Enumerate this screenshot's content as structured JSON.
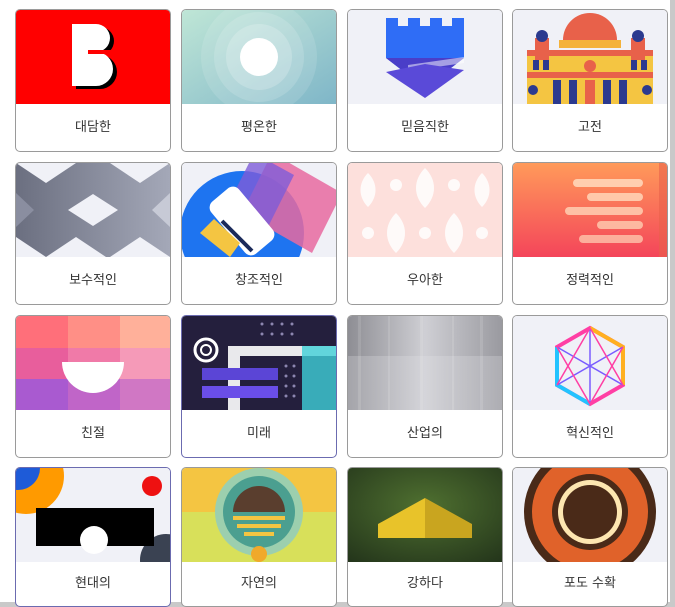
{
  "themes": [
    {
      "label": "대담한",
      "icon": "bold-b-thumbnail"
    },
    {
      "label": "평온한",
      "icon": "concentric-circles-thumbnail"
    },
    {
      "label": "믿음직한",
      "icon": "castle-shield-thumbnail"
    },
    {
      "label": "고전",
      "icon": "classic-building-thumbnail"
    },
    {
      "label": "보수적인",
      "icon": "hexagon-pattern-thumbnail"
    },
    {
      "label": "창조적인",
      "icon": "paint-roller-thumbnail"
    },
    {
      "label": "우아한",
      "icon": "damask-pattern-thumbnail"
    },
    {
      "label": "정력적인",
      "icon": "speed-lines-thumbnail"
    },
    {
      "label": "친절",
      "icon": "friendly-smile-thumbnail"
    },
    {
      "label": "미래",
      "icon": "futuristic-dark-thumbnail"
    },
    {
      "label": "산업의",
      "icon": "brushed-metal-thumbnail"
    },
    {
      "label": "혁신적인",
      "icon": "neon-hexagon-thumbnail"
    },
    {
      "label": "현대의",
      "icon": "modern-shapes-thumbnail"
    },
    {
      "label": "자연의",
      "icon": "nature-plant-thumbnail"
    },
    {
      "label": "강하다",
      "icon": "strong-chevron-thumbnail"
    },
    {
      "label": "포도 수확",
      "icon": "vintage-circle-thumbnail"
    }
  ]
}
